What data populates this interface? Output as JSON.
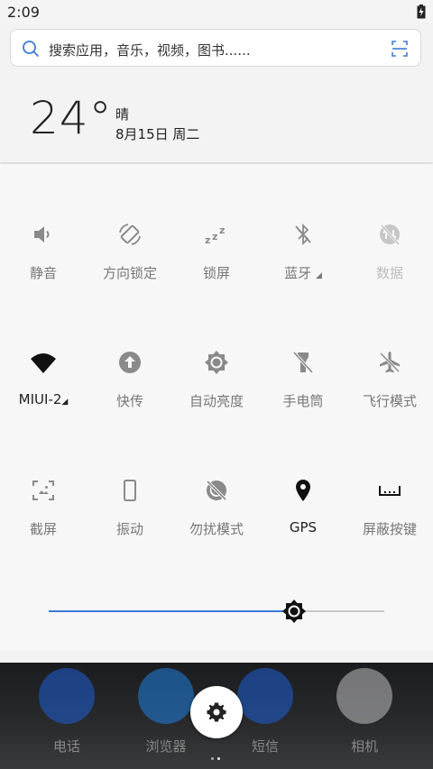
{
  "status_bar": {
    "time": "2:09"
  },
  "search": {
    "placeholder": "搜索应用，音乐，视频，图书......"
  },
  "weather": {
    "temperature": "24°",
    "condition": "晴",
    "date": "8月15日 周二"
  },
  "toggles": [
    {
      "label": "静音",
      "icon": "volume-icon",
      "state": "off"
    },
    {
      "label": "方向锁定",
      "icon": "rotation-lock-icon",
      "state": "off"
    },
    {
      "label": "锁屏",
      "icon": "sleep-zzz-icon",
      "state": "off"
    },
    {
      "label": "蓝牙",
      "icon": "bluetooth-off-icon",
      "state": "off",
      "has_dropdown": true
    },
    {
      "label": "数据",
      "icon": "mobile-data-off-icon",
      "state": "disabled"
    },
    {
      "label": "MIUI-2",
      "icon": "wifi-icon",
      "state": "on",
      "has_dropdown": true
    },
    {
      "label": "快传",
      "icon": "upload-icon",
      "state": "off"
    },
    {
      "label": "自动亮度",
      "icon": "auto-brightness-icon",
      "state": "off"
    },
    {
      "label": "手电筒",
      "icon": "flashlight-off-icon",
      "state": "off"
    },
    {
      "label": "飞行模式",
      "icon": "airplane-icon",
      "state": "off"
    },
    {
      "label": "截屏",
      "icon": "screenshot-icon",
      "state": "off"
    },
    {
      "label": "振动",
      "icon": "vibrate-icon",
      "state": "off"
    },
    {
      "label": "勿扰模式",
      "icon": "do-not-disturb-icon",
      "state": "off"
    },
    {
      "label": "GPS",
      "icon": "location-icon",
      "state": "on"
    },
    {
      "label": "屏蔽按键",
      "icon": "block-keys-icon",
      "state": "off"
    }
  ],
  "brightness": {
    "level": 0.73,
    "fill_color": "#3b7ad8"
  },
  "dock": {
    "apps": [
      {
        "label": "电话",
        "color": "#1e5fd6",
        "icon": "phone-icon"
      },
      {
        "label": "浏览器",
        "color": "#1f7fe0",
        "icon": "browser-icon"
      },
      {
        "label": "短信",
        "color": "#1e5fd6",
        "icon": "message-icon"
      },
      {
        "label": "相机",
        "color": "#bfbfbf",
        "icon": "camera-icon"
      }
    ]
  }
}
